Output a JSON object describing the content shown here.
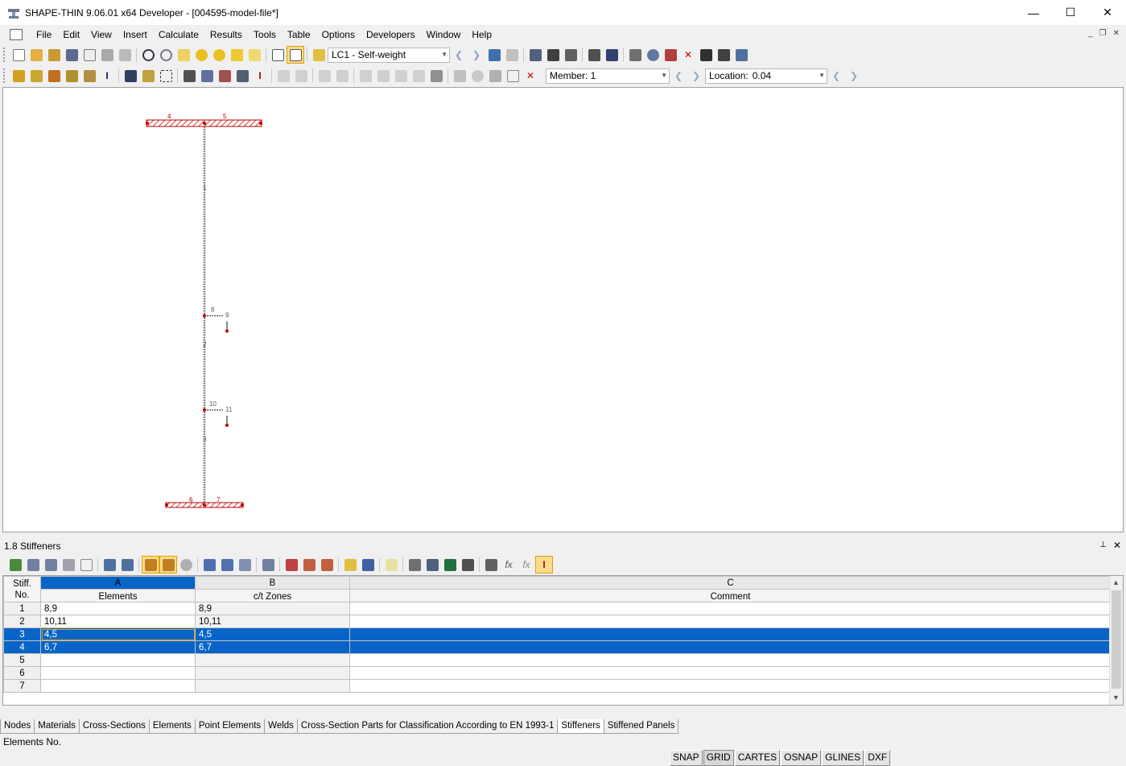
{
  "window": {
    "title": "SHAPE-THIN 9.06.01 x64 Developer - [004595-model-file*]",
    "minimize": "—",
    "maximize": "☐",
    "close": "✕"
  },
  "menu": [
    "File",
    "Edit",
    "View",
    "Insert",
    "Calculate",
    "Results",
    "Tools",
    "Table",
    "Options",
    "Developers",
    "Window",
    "Help"
  ],
  "toolbar1": {
    "load_case": "LC1 - Self-weight"
  },
  "toolbar2": {
    "member_label": "Member: 1",
    "location_label": "Location:",
    "location_value": "0.04"
  },
  "canvas": {
    "labels": [
      "4",
      "5",
      "1",
      "8",
      "9",
      "2",
      "10",
      "11",
      "3",
      "6",
      "7"
    ]
  },
  "panel": {
    "title": "1.8 Stiffeners",
    "pin": "⊥",
    "close": "✕"
  },
  "table": {
    "col_letters": [
      "A",
      "B",
      "C"
    ],
    "row_header": "Stiff.\nNo.",
    "headers": [
      "Elements",
      "c/t Zones",
      "Comment"
    ],
    "rows": [
      {
        "no": "1",
        "elements": "8,9",
        "zones": "8,9",
        "comment": ""
      },
      {
        "no": "2",
        "elements": "10,11",
        "zones": "10,11",
        "comment": ""
      },
      {
        "no": "3",
        "elements": "4,5",
        "zones": "4,5",
        "comment": ""
      },
      {
        "no": "4",
        "elements": "6,7",
        "zones": "6,7",
        "comment": ""
      },
      {
        "no": "5",
        "elements": "",
        "zones": "",
        "comment": ""
      },
      {
        "no": "6",
        "elements": "",
        "zones": "",
        "comment": ""
      },
      {
        "no": "7",
        "elements": "",
        "zones": "",
        "comment": ""
      }
    ]
  },
  "tabs": [
    "Nodes",
    "Materials",
    "Cross-Sections",
    "Elements",
    "Point Elements",
    "Welds",
    "Cross-Section Parts for Classification According to EN 1993-1",
    "Stiffeners",
    "Stiffened Panels"
  ],
  "status": {
    "text": "Elements No.",
    "buttons": [
      "SNAP",
      "GRID",
      "CARTES",
      "OSNAP",
      "GLINES",
      "DXF"
    ]
  }
}
